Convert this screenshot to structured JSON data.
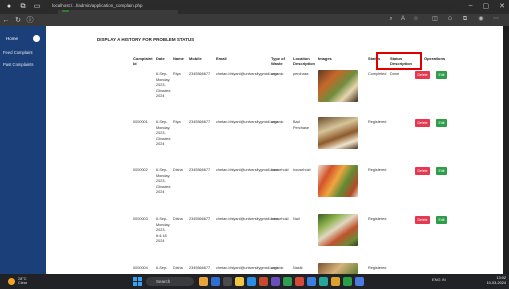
{
  "browser": {
    "tab_title": "Welcome",
    "url": "localhost:/...l/admin/application_complain.php"
  },
  "sidebar": {
    "home_label": "Home",
    "links": [
      "Feed Complaint",
      "Past Complaints"
    ]
  },
  "page": {
    "title": "DISPLAY A HISTORY FOR PROBLEM STATUS",
    "columns": {
      "complaint_id": [
        "Complaint",
        "Id"
      ],
      "date": "Date",
      "name": "Name",
      "mobile": "Mobile",
      "email": "Email",
      "type_waste": [
        "Type of",
        "Waste"
      ],
      "location": [
        "Location",
        "Description"
      ],
      "images": "Images",
      "status": "Status",
      "status_desc": [
        "Status",
        "Description"
      ],
      "operations": "Operations"
    },
    "rows": [
      {
        "id": "",
        "date": [
          "6-Sep-",
          "Monday,",
          "2023,",
          "Ghosted",
          "2024"
        ],
        "name": "Riya",
        "mobile": "2345566677",
        "email": "chetan.bhiyani@universitygmail.com",
        "type": "organic",
        "location": "perchase",
        "status": "Completed",
        "status_desc": "Done",
        "remove": "Delete",
        "edit": "Edit"
      },
      {
        "id": "0000001",
        "date": [
          "6-Sep-",
          "Monday,",
          "2023,",
          "Ghosted",
          "2024"
        ],
        "name": "Riya",
        "mobile": "2345566677",
        "email": "chetan.bhiyani@universitygmail.com",
        "type": "organic",
        "location": [
          "Bad",
          "Perchase"
        ],
        "status": "Registered",
        "status_desc": "",
        "remove": "Delete",
        "edit": "Edit"
      },
      {
        "id": "0000002",
        "date": [
          "6-Sep-",
          "Monday,",
          "2023,",
          "Ghosted",
          "2024"
        ],
        "name": "Disha",
        "mobile": "2345566677",
        "email": "chetan.bhiyani@universitygmail.com",
        "type": "household",
        "location": "household",
        "status": "Registered",
        "status_desc": "",
        "remove": "Delete",
        "edit": "Edit"
      },
      {
        "id": "0000003",
        "date": [
          "6-Sep-",
          "Monday,",
          "2023,",
          "6:4:18",
          "2024"
        ],
        "name": "Disha",
        "mobile": "2345566677",
        "email": "chetan.bhiyani@universitygmail.com",
        "type": "household",
        "location": "Nail",
        "status": "Registered",
        "status_desc": "",
        "remove": "Delete",
        "edit": "Edit"
      },
      {
        "id": "0000004",
        "date": [
          "6-Sep-"
        ],
        "name": "Disha",
        "mobile": "2345566677",
        "email": "chetan.bhiyani@universitygmail.com",
        "type": "organic",
        "location": "Nasik",
        "status": "Registered",
        "status_desc": "",
        "remove": "",
        "edit": ""
      }
    ]
  },
  "taskbar": {
    "weather_temp": "28°C",
    "weather_desc": "Clear",
    "search_placeholder": "Search",
    "tray_lang": "ENG IN",
    "time": "13:02",
    "date": "10-03-2024"
  },
  "colors": {
    "sidebar": "#1b3f78",
    "delete_button": "#e53950",
    "edit_button": "#2e9d4a",
    "highlight_box": "#e00000"
  }
}
